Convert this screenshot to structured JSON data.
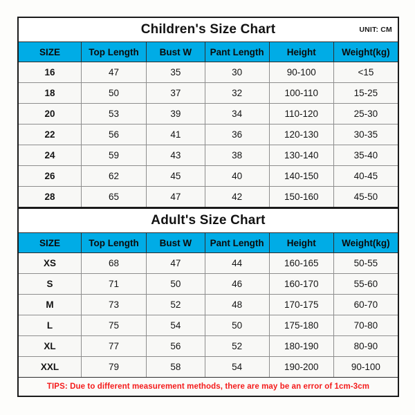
{
  "children": {
    "title": "Children's Size Chart",
    "unit_label": "UNIT: CM",
    "columns": [
      "SIZE",
      "Top Length",
      "Bust W",
      "Pant Length",
      "Height",
      "Weight(kg)"
    ],
    "rows": [
      [
        "16",
        "47",
        "35",
        "30",
        "90-100",
        "<15"
      ],
      [
        "18",
        "50",
        "37",
        "32",
        "100-110",
        "15-25"
      ],
      [
        "20",
        "53",
        "39",
        "34",
        "110-120",
        "25-30"
      ],
      [
        "22",
        "56",
        "41",
        "36",
        "120-130",
        "30-35"
      ],
      [
        "24",
        "59",
        "43",
        "38",
        "130-140",
        "35-40"
      ],
      [
        "26",
        "62",
        "45",
        "40",
        "140-150",
        "40-45"
      ],
      [
        "28",
        "65",
        "47",
        "42",
        "150-160",
        "45-50"
      ]
    ]
  },
  "adult": {
    "title": "Adult's Size Chart",
    "columns": [
      "SIZE",
      "Top Length",
      "Bust W",
      "Pant Length",
      "Height",
      "Weight(kg)"
    ],
    "rows": [
      [
        "XS",
        "68",
        "47",
        "44",
        "160-165",
        "50-55"
      ],
      [
        "S",
        "71",
        "50",
        "46",
        "160-170",
        "55-60"
      ],
      [
        "M",
        "73",
        "52",
        "48",
        "170-175",
        "60-70"
      ],
      [
        "L",
        "75",
        "54",
        "50",
        "175-180",
        "70-80"
      ],
      [
        "XL",
        "77",
        "56",
        "52",
        "180-190",
        "80-90"
      ],
      [
        "XXL",
        "79",
        "58",
        "54",
        "190-200",
        "90-100"
      ]
    ]
  },
  "tips": "TIPS: Due to different measurement methods, there are may be an error of 1cm-3cm",
  "colors": {
    "header_blue": "#00ace6",
    "tips_red": "#f41b1b",
    "border_dark": "#1a1a1a",
    "cell_bg": "#f8f8f6"
  }
}
